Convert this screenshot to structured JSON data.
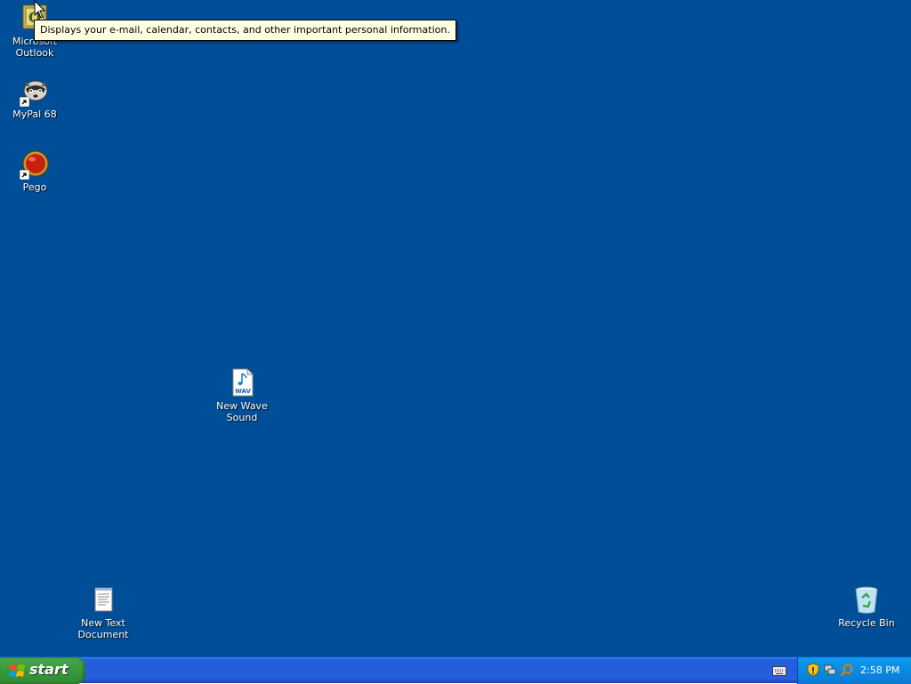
{
  "desktop": {
    "background_color": "#004e98",
    "icons": {
      "outlook": {
        "label": "Microsoft\nOutlook",
        "icon": "outlook-icon"
      },
      "mypal": {
        "label": "MyPal 68",
        "icon": "raccoon-icon"
      },
      "pego": {
        "label": "Pego",
        "icon": "red-ball-icon"
      },
      "wave": {
        "label": "New Wave\nSound",
        "icon": "wav-file-icon"
      },
      "text_doc": {
        "label": "New Text\nDocument",
        "icon": "notepad-file-icon"
      },
      "recycle_bin": {
        "label": "Recycle Bin",
        "icon": "recycle-bin-icon"
      }
    },
    "tooltip": "Displays your e-mail, calendar, contacts, and other important personal information."
  },
  "taskbar": {
    "start_label": "start",
    "start_color": "#3c9a3f",
    "taskbar_color": "#245edb",
    "tray_color": "#0b8ae2",
    "tray_icons": [
      "security-shield-icon",
      "network-icon",
      "search-icon"
    ],
    "quick_icon": "keyboard-icon",
    "clock": "2:58 PM"
  }
}
